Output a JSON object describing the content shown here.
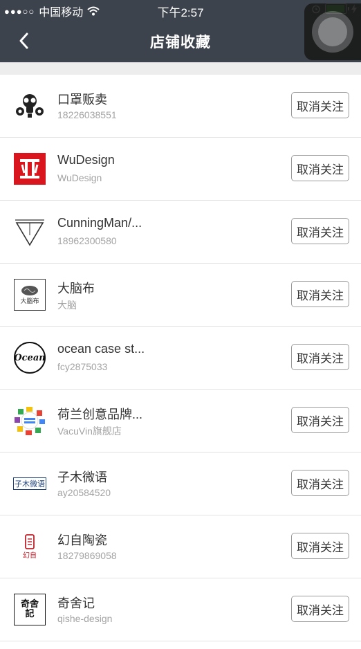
{
  "status_bar": {
    "carrier": "中国移动",
    "time": "下午2:57"
  },
  "nav": {
    "title": "店铺收藏"
  },
  "shops": [
    {
      "name": "口罩贩卖",
      "sub": "18226038551",
      "logo": "gas-mask-logo"
    },
    {
      "name": "WuDesign",
      "sub": "WuDesign",
      "logo": "wudesign-logo"
    },
    {
      "name": "CunningMan/...",
      "sub": "18962300580",
      "logo": "cunningman-triangle-logo"
    },
    {
      "name": "大脑布",
      "sub": "大脑",
      "logo": "brain-logo",
      "logo_text": "大腦布"
    },
    {
      "name": "ocean case st...",
      "sub": "fcy2875033",
      "logo": "ocean-logo",
      "logo_text": "Ocean"
    },
    {
      "name": "荷兰创意品牌...",
      "sub": "VacuVin旗舰店",
      "logo": "dutch-creative-logo"
    },
    {
      "name": "子木微语",
      "sub": "ay20584520",
      "logo": "zimu-logo",
      "logo_text": "子木微语"
    },
    {
      "name": "幻自陶瓷",
      "sub": "18279869058",
      "logo": "ceramic-logo",
      "logo_text": "幻自"
    },
    {
      "name": "奇舍记",
      "sub": "qishe-design",
      "logo": "qishe-logo",
      "logo_text": "奇舍記"
    }
  ],
  "buttons": {
    "unfollow_label": "取消关注"
  },
  "colors": {
    "nav_bg": "#3d434d",
    "wudesign_red": "#d9151d",
    "battery_green": "#3ad33a"
  }
}
